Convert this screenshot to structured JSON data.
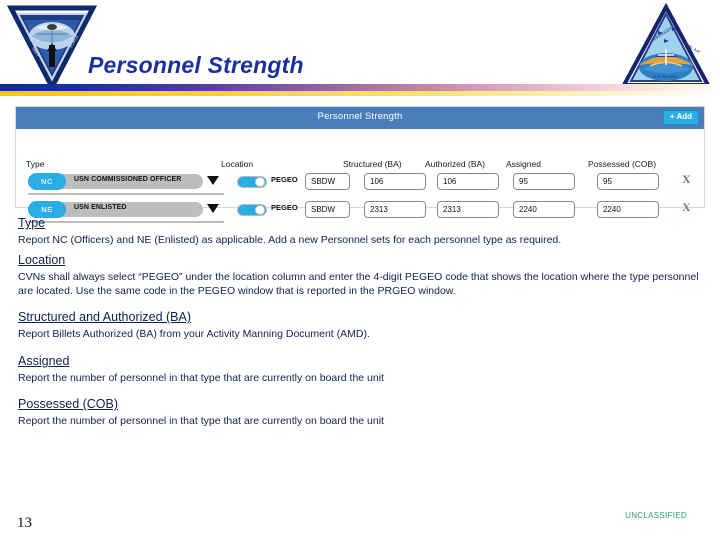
{
  "slide": {
    "title": "Personnel Strength",
    "page_number": "13",
    "classification": "UNCLASSIFIED"
  },
  "logos": {
    "left": "navy-triangle-insignia-icon",
    "right": "aviation-triangle-emblem-icon"
  },
  "panel": {
    "title": "Personnel Strength",
    "add_label": "+ Add",
    "columns": {
      "type": "Type",
      "location": "Location",
      "structured": "Structured (BA)",
      "authorized": "Authorized (BA)",
      "assigned": "Assigned",
      "possessed": "Possessed (COB)"
    },
    "rows": [
      {
        "badge": "NC",
        "type_name": "USN COMMISSIONED OFFICER",
        "toggle_on": true,
        "location_label": "PEGEO",
        "location_code": "SBDW",
        "structured": "106",
        "authorized": "106",
        "assigned": "95",
        "possessed": "95",
        "delete_label": "X"
      },
      {
        "badge": "NE",
        "type_name": "USN ENLISTED",
        "toggle_on": true,
        "location_label": "PEGEO",
        "location_code": "SBDW",
        "structured": "2313",
        "authorized": "2313",
        "assigned": "2240",
        "possessed": "2240",
        "delete_label": "X"
      }
    ]
  },
  "sections": [
    {
      "heading": "Type",
      "body": "Report NC (Officers) and NE (Enlisted) as applicable.  Add a new Personnel sets for each personnel type as required."
    },
    {
      "heading": "Location",
      "body": "CVNs shall always select “PEGEO” under the location column and enter the 4-digit PEGEO code that shows the location where the type personnel are located. Use the same code in the PEGEO window that is reported in the PRGEO window."
    },
    {
      "heading": "Structured and Authorized (BA)",
      "body": "Report Billets Authorized (BA) from your Activity Manning Document (AMD)."
    },
    {
      "heading": "Assigned",
      "body": "Report the number of personnel in that type that are currently on board the unit"
    },
    {
      "heading": "Possessed (COB)",
      "body": "Report the number of personnel in that type that are currently on board the unit"
    }
  ],
  "colors": {
    "title_blue": "#1b2f9e",
    "panel_header": "#4a7ebb",
    "accent_cyan": "#29ade4",
    "body_text": "#0f2350",
    "classification_green": "#2f9e6b"
  }
}
